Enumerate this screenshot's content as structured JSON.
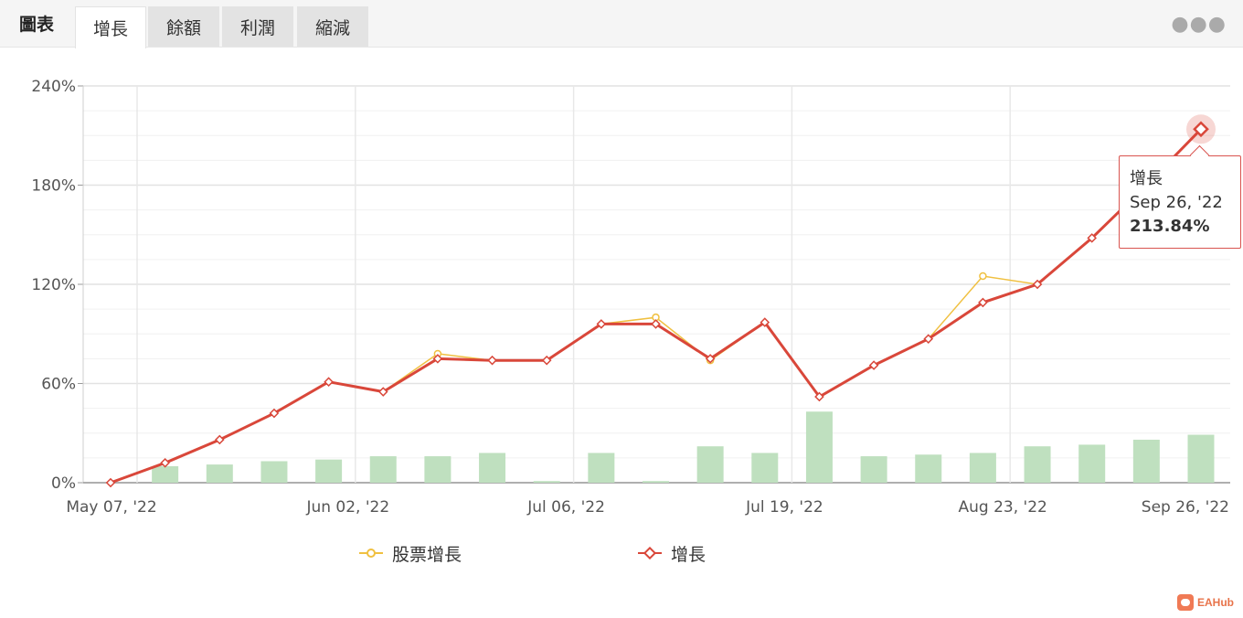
{
  "tabs": {
    "title": "圖表",
    "items": [
      {
        "label": "增長",
        "active": true
      },
      {
        "label": "餘額",
        "active": false
      },
      {
        "label": "利潤",
        "active": false
      },
      {
        "label": "縮減",
        "active": false
      }
    ],
    "more_icon": "more-horizontal-icon"
  },
  "tooltip": {
    "series": "增長",
    "date": "Sep 26, '22",
    "value": "213.84%"
  },
  "brand": {
    "name": "EAHub"
  },
  "colors": {
    "growth": "#d9473a",
    "equity_growth": "#f0c040",
    "bars": "#bfe0bf",
    "grid": "#e6e6e6"
  },
  "chart_data": {
    "type": "line",
    "x_tick_labels": [
      "May 07, '22",
      "Jun 02, '22",
      "Jul 06, '22",
      "Jul 19, '22",
      "Aug 23, '22",
      "Sep 26, '22"
    ],
    "y_tick_labels": [
      "0%",
      "60%",
      "120%",
      "180%",
      "240%"
    ],
    "ylim": [
      0,
      240
    ],
    "y_unit": "%",
    "grid": true,
    "legend_position": "bottom",
    "series": [
      {
        "name": "股票增長",
        "type": "line",
        "values": [
          0,
          12,
          26,
          42,
          61,
          55,
          78,
          74,
          74,
          96,
          100,
          74,
          97,
          52,
          71,
          87,
          125,
          120,
          148,
          180,
          214
        ]
      },
      {
        "name": "增長",
        "type": "line",
        "values": [
          0,
          12,
          26,
          42,
          61,
          55,
          75,
          74,
          74,
          96,
          96,
          75,
          97,
          52,
          71,
          87,
          109,
          120,
          148,
          180,
          213.84
        ]
      },
      {
        "name": "",
        "type": "bar",
        "values": [
          10,
          11,
          13,
          14,
          16,
          16,
          18,
          1,
          18,
          1,
          22,
          18,
          43,
          16,
          17,
          18,
          22,
          23,
          26,
          29
        ]
      }
    ]
  }
}
